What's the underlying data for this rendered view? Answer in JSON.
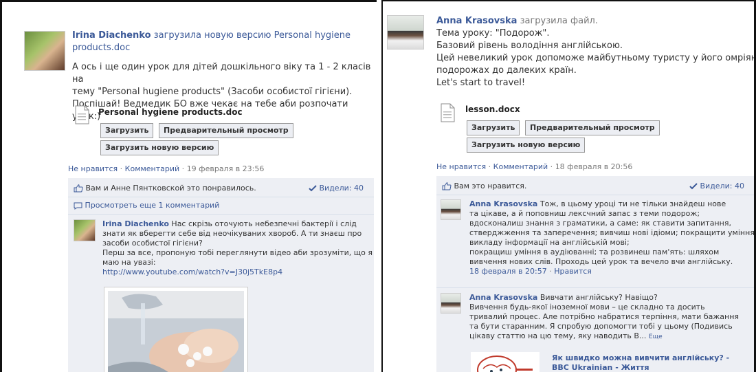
{
  "left": {
    "author": "Irina Diachenko",
    "action": "загрузила новую версию Personal hygiene products.doc",
    "body_lines": [
      "А ось і ще один урок для дітей дошкільного віку та 1 - 2 класів на",
      "тему \"Personal hugiene products\" (Засоби особистої гігієни).",
      "Поспішай! Ведмедик БО вже чекає на тебе аби розпочати урок:)"
    ],
    "file_name": "Personal hygiene products.doc",
    "btn_download": "Загрузить",
    "btn_preview": "Предварительный просмотр",
    "btn_new_version": "Загрузить новую версию",
    "meta": {
      "unlike": "Не нравится",
      "comment": "Комментарий",
      "date": "19 февраля в 23:56"
    },
    "likes_text": "Вам и Анне Пянтковской это понравилось.",
    "seen": "Видели: 40",
    "view_more": "Просмотреть еще 1 комментарий",
    "comment": {
      "author": "Irina Diachenko",
      "lines": [
        "Нас скрізь оточують небезпечні бактерії і слід",
        "знати як вберегти себе від неочікуваних хвороб. А ти знаєш про",
        "засоби особистої гігієни?",
        "Перш за все, пропоную тобі переглянути відео аби зрозуміти, що я",
        "маю на увазі:"
      ],
      "url": "http://www.youtube.com/watch?v=J30j5TkE8p4"
    }
  },
  "right": {
    "author": "Anna Krasovska",
    "action": "загрузила файл.",
    "body_lines": [
      "Тема уроку: \"Подорож\".",
      "Базовий рівень володіння англійською.",
      "Цей невеликий урок допоможе майбутньому туристу у його омріяних",
      "подорожах до далеких країн.",
      "Let's start to travel!"
    ],
    "file_name": "lesson.docx",
    "btn_download": "Загрузить",
    "btn_preview": "Предварительный просмотр",
    "btn_new_version": "Загрузить новую версию",
    "meta": {
      "unlike": "Не нравится",
      "comment": "Комментарий",
      "date": "18 февраля в 20:56"
    },
    "likes_text": "Вам это нравится.",
    "seen": "Видели: 40",
    "comment1": {
      "author": "Anna Krasovska",
      "lines": [
        "Тож, в цьому уроці ти не тільки знайдеш нове",
        "та цікаве, а й поповниш лексчний запас з теми подорож;",
        "вдосконалиш знання з граматики, а саме: як ставити запитання,",
        "стверджження та заперечення; вивчиш нові ідіоми; покращити уміння",
        "викладу інформації на англійській мові;",
        "покращиш уміння в аудіюванні; та розвинеш пам'ять: шляхом",
        "вивчення нових слів. Проходь цей урок та вечело вчи англійську."
      ],
      "date": "18 февраля в 20:57",
      "like": "Нравится"
    },
    "comment2": {
      "author": "Anna Krasovska",
      "lines": [
        "Вивчати англійську? Навіщо?",
        "Вивчення будь-якої іноземної мови – це складно та досить",
        "тривалий процес. Але потрібно набратися терпіння, мати бажання",
        "та бути старанним. Я спробую допомогти тобі у цьому (Подивись",
        "цікаву статтю на цю тему, яку наводить В..."
      ],
      "more": "Еще",
      "link_title_1": "Як швидко можна вивчити англійську? -",
      "link_title_2": "BBC Ukrainian - Життя"
    }
  },
  "colors": {
    "link": "#3b5998",
    "comment_bg": "#edeff4",
    "button_bg": "#eceef3"
  }
}
